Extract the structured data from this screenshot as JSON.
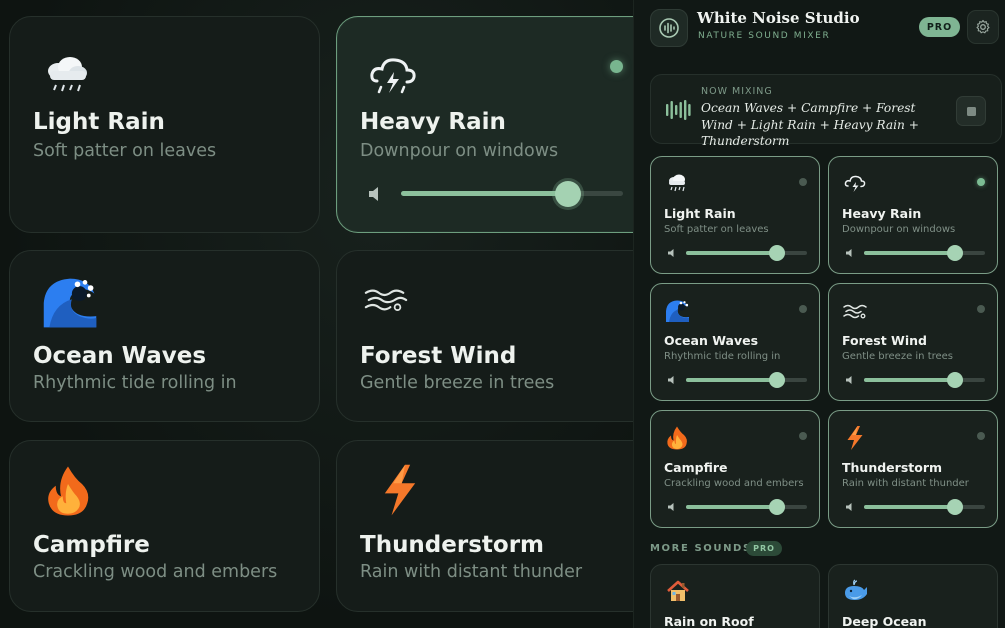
{
  "zoom": {
    "cards": [
      {
        "id": "light-rain",
        "title": "Light Rain",
        "subtitle": "Soft patter on leaves",
        "icon": "cloud-rain-icon",
        "active": false
      },
      {
        "id": "heavy-rain",
        "title": "Heavy Rain",
        "subtitle": "Downpour on windows",
        "icon": "cloud-storm-icon",
        "active": true,
        "volume": 0.75
      },
      {
        "id": "ocean-waves",
        "title": "Ocean Waves",
        "subtitle": "Rhythmic tide rolling in",
        "icon": "wave-icon",
        "active": false
      },
      {
        "id": "forest-wind",
        "title": "Forest Wind",
        "subtitle": "Gentle breeze in trees",
        "icon": "wind-icon",
        "active": false
      },
      {
        "id": "campfire",
        "title": "Campfire",
        "subtitle": "Crackling wood and embers",
        "icon": "fire-icon",
        "active": false
      },
      {
        "id": "thunderstorm",
        "title": "Thunderstorm",
        "subtitle": "Rain with distant thunder",
        "icon": "lightning-icon",
        "active": false
      }
    ]
  },
  "header": {
    "title": "White Noise Studio",
    "subtitle": "NATURE SOUND MIXER",
    "badge": "PRO"
  },
  "now_mixing": {
    "label": "NOW MIXING",
    "text": "Ocean Waves + Campfire + Forest Wind + Light Rain + Heavy Rain + Thunderstorm"
  },
  "sounds": [
    {
      "title": "Light Rain",
      "subtitle": "Soft patter on leaves",
      "icon": "cloud-rain-icon",
      "on": false,
      "volume": 0.75
    },
    {
      "title": "Heavy Rain",
      "subtitle": "Downpour on windows",
      "icon": "cloud-storm-icon",
      "on": true,
      "volume": 0.75
    },
    {
      "title": "Ocean Waves",
      "subtitle": "Rhythmic tide rolling in",
      "icon": "wave-icon",
      "on": false,
      "volume": 0.75
    },
    {
      "title": "Forest Wind",
      "subtitle": "Gentle breeze in trees",
      "icon": "wind-icon",
      "on": false,
      "volume": 0.75
    },
    {
      "title": "Campfire",
      "subtitle": "Crackling wood and embers",
      "icon": "fire-icon",
      "on": false,
      "volume": 0.75
    },
    {
      "title": "Thunderstorm",
      "subtitle": "Rain with distant thunder",
      "icon": "lightning-icon",
      "on": false,
      "volume": 0.75
    }
  ],
  "more": {
    "label": "MORE SOUNDS",
    "badge": "PRO",
    "items": [
      {
        "title": "Rain on Roof",
        "icon": "house-icon"
      },
      {
        "title": "Deep Ocean",
        "icon": "whale-icon"
      }
    ]
  },
  "colors": {
    "accent": "#8cc09c",
    "background": "#111815",
    "card": "#19211d"
  }
}
